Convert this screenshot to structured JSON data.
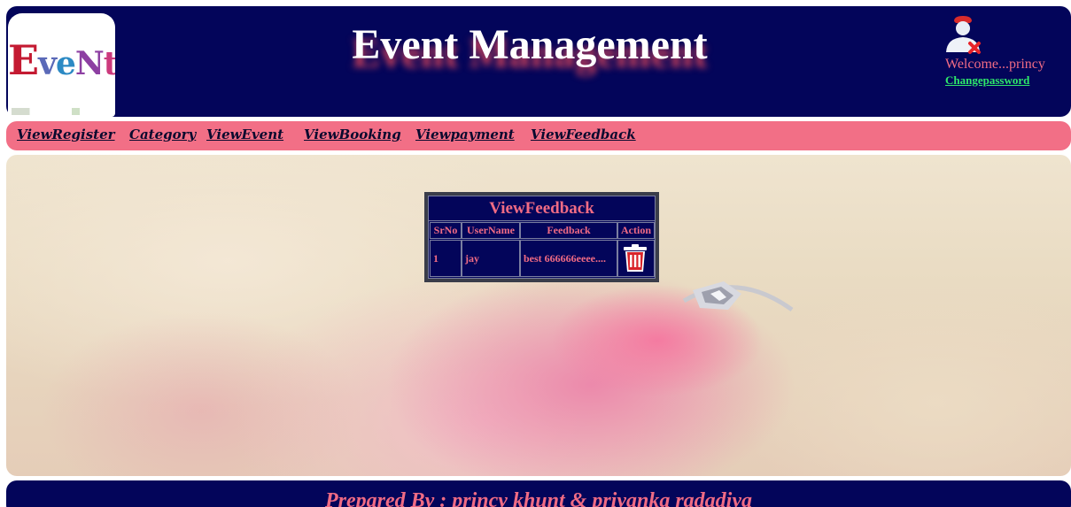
{
  "header": {
    "logo_text": "EveNts",
    "title": "Event Management",
    "user_icon": "user-remove-icon",
    "welcome": "Welcome...princy",
    "change_password": "Changepassword"
  },
  "nav": {
    "items": [
      {
        "label": "ViewRegister"
      },
      {
        "label": "Category"
      },
      {
        "label": "ViewEvent"
      },
      {
        "label": "ViewBooking"
      },
      {
        "label": "Viewpayment"
      },
      {
        "label": "ViewFeedback"
      }
    ]
  },
  "feedback_table": {
    "title": "ViewFeedback",
    "columns": [
      "SrNo",
      "UserName",
      "Feedback",
      "Action"
    ],
    "rows": [
      {
        "srno": "1",
        "username": "jay",
        "feedback": "best 666666eeee....",
        "action_icon": "trash-icon"
      }
    ]
  },
  "footer": {
    "text": "Prepared By : princy khunt & priyanka radadiya"
  },
  "colors": {
    "navy": "#03055a",
    "pink": "#f26f86",
    "text_pink": "#f06b84",
    "link_green": "#2ee86a"
  }
}
